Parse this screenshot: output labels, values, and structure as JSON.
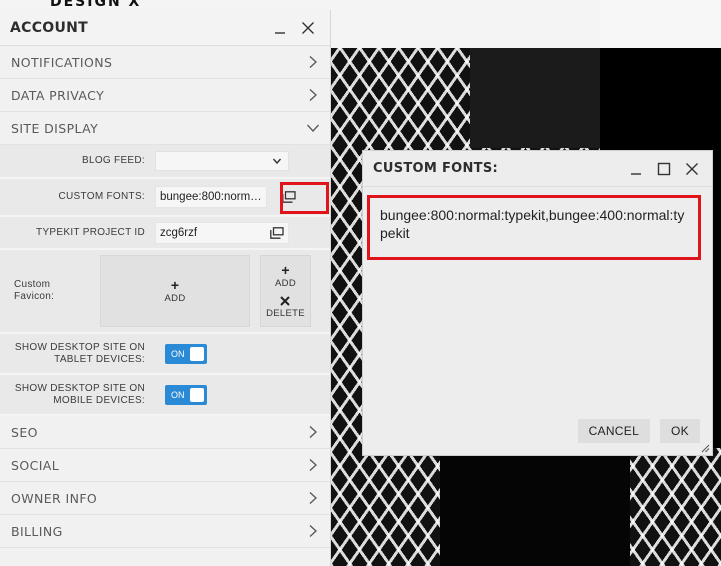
{
  "background": {
    "brand_text": "DESIGN X"
  },
  "panel": {
    "title": "ACCOUNT",
    "sections_top": [
      {
        "label": "NOTIFICATIONS",
        "state": "collapsed"
      },
      {
        "label": "DATA PRIVACY",
        "state": "collapsed"
      },
      {
        "label": "SITE DISPLAY",
        "state": "expanded"
      }
    ],
    "site_display": {
      "blog_feed_label": "BLOG FEED:",
      "blog_feed_value": "",
      "custom_fonts_label": "CUSTOM FONTS:",
      "custom_fonts_value": "bungee:800:normal:typekit,bungee:400:normal:typekit",
      "typekit_label": "TYPEKIT PROJECT ID",
      "typekit_value": "zcg6rzf",
      "favicon_label": "Custom Favicon:",
      "favicon_add_label": "ADD",
      "favicon_add_btn": "ADD",
      "favicon_delete_btn": "DELETE",
      "tablet_label_1": "SHOW DESKTOP SITE ON",
      "tablet_label_2": "TABLET DEVICES:",
      "tablet_toggle": "ON",
      "mobile_label_1": "SHOW DESKTOP SITE ON",
      "mobile_label_2": "MOBILE DEVICES:",
      "mobile_toggle": "ON"
    },
    "sections_bottom": [
      {
        "label": "SEO"
      },
      {
        "label": "SOCIAL"
      },
      {
        "label": "OWNER INFO"
      },
      {
        "label": "BILLING"
      }
    ]
  },
  "dialog": {
    "title": "CUSTOM FONTS:",
    "content": "bungee:800:normal:typekit,bungee:400:normal:typekit",
    "cancel_label": "CANCEL",
    "ok_label": "OK"
  },
  "colors": {
    "highlight_red": "#e0141b",
    "toggle_blue": "#2b8ad6"
  }
}
